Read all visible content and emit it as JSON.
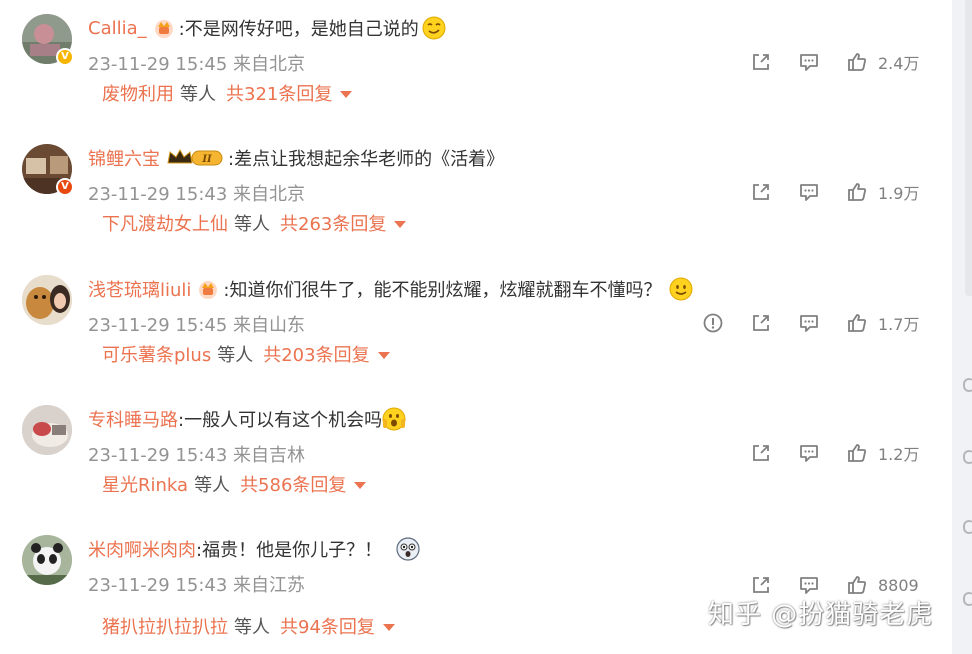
{
  "comments": [
    {
      "username": "Callia_",
      "text": ":不是网传好吧，是她自己说的",
      "time": "23-11-29 15:45",
      "location": "来自北京",
      "likes": "2.4万",
      "replier": "废物利用",
      "replier_suffix": "等人",
      "reply_total": "共321条回复",
      "badge": "V"
    },
    {
      "username": "锦鲤六宝",
      "text": ":差点让我想起余华老师的《活着》",
      "time": "23-11-29 15:43",
      "location": "来自北京",
      "likes": "1.9万",
      "replier": "下凡渡劫女上仙",
      "replier_suffix": "等人",
      "reply_total": "共263条回复",
      "badge": "V",
      "medal_text": "II"
    },
    {
      "username": "浅苍琉璃liuli",
      "text": ":知道你们很牛了，能不能别炫耀，炫耀就翻车不懂吗？",
      "time": "23-11-29 15:45",
      "location": "来自山东",
      "likes": "1.7万",
      "replier": "可乐薯条plus",
      "replier_suffix": "等人",
      "reply_total": "共203条回复"
    },
    {
      "username": "专科睡马路",
      "text": ":一般人可以有这个机会吗",
      "time": "23-11-29 15:43",
      "location": "来自吉林",
      "likes": "1.2万",
      "replier": "星光Rinka",
      "replier_suffix": "等人",
      "reply_total": "共586条回复"
    },
    {
      "username": "米肉啊米肉肉",
      "text": ":福贵！他是你儿子？！",
      "time": "23-11-29 15:43",
      "location": "来自江苏",
      "likes": "8809",
      "replier": "猪扒拉扒拉扒拉",
      "replier_suffix": "等人",
      "reply_total": "共94条回复"
    }
  ],
  "watermark": "知乎 @扮猫骑老虎",
  "colors": {
    "accent": "#eb7350",
    "meta": "#939393",
    "icon": "#808080",
    "text": "#333333"
  },
  "icons": [
    "share-icon",
    "comment-icon",
    "like-icon",
    "report-icon",
    "caret-down-icon"
  ]
}
